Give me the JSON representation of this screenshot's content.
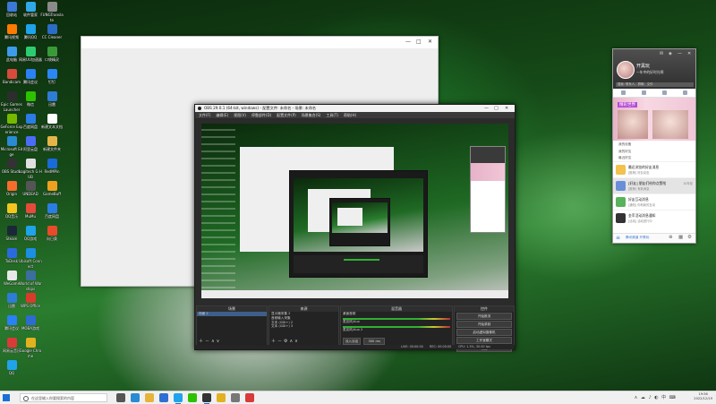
{
  "desktop": {
    "icons_col1": [
      {
        "label": "回收站",
        "color": "#3b78d8"
      },
      {
        "label": "腾讯视频",
        "color": "#ff7a00"
      },
      {
        "label": "此电脑",
        "color": "#3d9be9"
      },
      {
        "label": "Bandicam",
        "color": "#d94a3d"
      },
      {
        "label": "Epic Games Launcher",
        "color": "#2d2d2d"
      },
      {
        "label": "GeForce Experience",
        "color": "#76b900"
      },
      {
        "label": "Microsoft Edge",
        "color": "#2a8bd3"
      },
      {
        "label": "OBS Studio",
        "color": "#333333"
      },
      {
        "label": "Origin",
        "color": "#f56c2d"
      },
      {
        "label": "QQ音乐",
        "color": "#f4c51d"
      },
      {
        "label": "Steam",
        "color": "#1b2838"
      },
      {
        "label": "ToDesk",
        "color": "#2a6ae0"
      },
      {
        "label": "WeGame",
        "color": "#e8e8e8"
      },
      {
        "label": "迅雷",
        "color": "#2e7cd6"
      },
      {
        "label": "腾讯会议",
        "color": "#2a80f5"
      },
      {
        "label": "网易云音乐",
        "color": "#d93a3a"
      },
      {
        "label": "QQ",
        "color": "#1fa3ea"
      }
    ],
    "icons_col2": [
      {
        "label": "软件管家",
        "color": "#2fa9e8"
      },
      {
        "label": "腾讯QQ",
        "color": "#1fa3ea"
      },
      {
        "label": "网易UU加速器",
        "color": "#2ecc71"
      },
      {
        "label": "腾讯会议",
        "color": "#2a80f5"
      },
      {
        "label": "微信",
        "color": "#2dc100"
      },
      {
        "label": "百度网盘",
        "color": "#2c7ce6"
      },
      {
        "label": "阿里云盘",
        "color": "#4a6cf7"
      },
      {
        "label": "Logitech G HUB",
        "color": "#e0e0e0"
      },
      {
        "label": "UNDEAD",
        "color": "#555555"
      },
      {
        "label": "MuMu",
        "color": "#e64a3b"
      },
      {
        "label": "QQ游戏",
        "color": "#1fa3ea"
      },
      {
        "label": "Ubisoft Connect",
        "color": "#1a8fe3"
      },
      {
        "label": "World of Warships",
        "color": "#3c6e9e"
      },
      {
        "label": "WPS Office",
        "color": "#d83b2c"
      },
      {
        "label": "MOBA游戏",
        "color": "#2d6bd1"
      },
      {
        "label": "Google Chrome",
        "color": "#e3b11f"
      }
    ],
    "icons_col3": [
      {
        "label": "FUNGTranslate",
        "color": "#8a8a8a"
      },
      {
        "label": "CC Cleaner",
        "color": "#2b6cc4"
      },
      {
        "label": "口袋精灵",
        "color": "#3a9a3a"
      },
      {
        "label": "钉钉",
        "color": "#2a87f5"
      },
      {
        "label": "迅雷",
        "color": "#2e7cd6"
      },
      {
        "label": "新建文本文档",
        "color": "#ffffff"
      },
      {
        "label": "新建文件夹",
        "color": "#e6b54a"
      },
      {
        "label": "RedMPin",
        "color": "#1a6ad8"
      },
      {
        "label": "GameBuff",
        "color": "#f0a020"
      },
      {
        "label": "百度网盘",
        "color": "#2c7ce6"
      },
      {
        "label": "向日葵",
        "color": "#e84a2b"
      }
    ]
  },
  "obs": {
    "title": "OBS 29.0.1 (64-bit, windows) - 配置文件: 未命名 - 场景: 未命名",
    "menu": [
      "文件(F)",
      "编辑(E)",
      "视图(V)",
      "停靠部件(D)",
      "配置文件(P)",
      "场景集合(S)",
      "工具(T)",
      "帮助(H)"
    ],
    "docks": {
      "scenes": {
        "title": "场景",
        "items": [
          "场景 2"
        ]
      },
      "sources": {
        "title": "来源",
        "items": [
          "显示器采集 2",
          "音频输入采集",
          "文本 (GDI+) 2",
          "文本 (GDI+) 3"
        ]
      },
      "mixer": {
        "title": "混音器",
        "channels": [
          "桌面音频",
          "麦克风/Aux",
          "麦克风/Aux 2"
        ],
        "levels": [
          "0.0 dB",
          "0.0 dB",
          "0.0 dB"
        ]
      },
      "transitions": {
        "title": "转场特效",
        "fade": "淡入淡出",
        "duration_label": "时长",
        "duration": "300 ms"
      },
      "controls": {
        "title": "控件",
        "buttons": [
          "开始推流",
          "开始录制",
          "启动虚拟摄像机",
          "工作室模式",
          "设置",
          "退出"
        ]
      }
    },
    "status": {
      "live": "LIVE: 00:00:00",
      "rec": "REC: 00:00:00",
      "cpu": "CPU: 1.3%, 30.00 fps",
      "kbps": "kb/s: 0"
    }
  },
  "qq": {
    "username": "开黑玩",
    "signature": "一年中的好时光啊",
    "search_placeholder": "搜索: 联系人、群聊、文件",
    "banner_text": "精彩世界",
    "groups": [
      "我的设备",
      "我的好友",
      "最近好友"
    ],
    "messages": [
      {
        "title": "最近浏览的好友消息",
        "sub": "[推荐] 好友动态",
        "time": ""
      },
      {
        "title": "[好友] 朋友们给你点赞啦",
        "sub": "[推荐] 有新消息",
        "time": "10年前"
      },
      {
        "title": "好友互动消息",
        "sub": "[通知] 你有新的互动",
        "time": ""
      },
      {
        "title": "金币活动消息通知",
        "sub": "[活动] 活动进行中",
        "time": ""
      }
    ],
    "footer_link": "腾讯频道 开黑玩"
  },
  "taskbar": {
    "search_placeholder": "在这里输入你要搜索的内容",
    "clock_time": "19:56",
    "clock_date": "2022/12/19",
    "apps": [
      {
        "name": "task-view",
        "color": "#555555"
      },
      {
        "name": "edge",
        "color": "#2a8bd3"
      },
      {
        "name": "file-explorer",
        "color": "#e8b33a"
      },
      {
        "name": "store",
        "color": "#2f6fd1"
      },
      {
        "name": "qq",
        "color": "#1fa3ea"
      },
      {
        "name": "wechat",
        "color": "#2dc100"
      },
      {
        "name": "obs",
        "color": "#333333"
      },
      {
        "name": "chrome",
        "color": "#e3b11f"
      },
      {
        "name": "settings",
        "color": "#777777"
      },
      {
        "name": "music",
        "color": "#d93a3a"
      }
    ],
    "tray_icons": "∧ ☁ ♪ ◐ 中 ⌨"
  }
}
